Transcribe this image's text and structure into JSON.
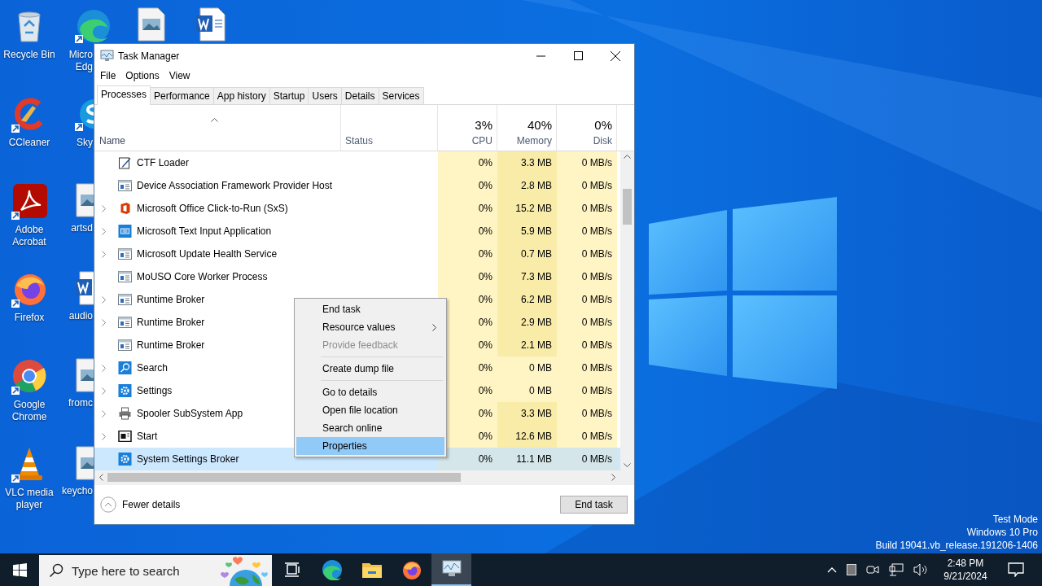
{
  "desktop_icons_top": [
    {
      "kind": "image"
    },
    {
      "kind": "word"
    }
  ],
  "desktop_icons": [
    {
      "label": "Recycle Bin",
      "kind": "recycle",
      "shortcut": false
    },
    {
      "label": "CCleaner",
      "kind": "ccleaner",
      "shortcut": true
    },
    {
      "label": "Adobe Acrobat",
      "kind": "acrobat",
      "shortcut": true
    },
    {
      "label": "Firefox",
      "kind": "firefox",
      "shortcut": true
    },
    {
      "label": "Google Chrome",
      "kind": "chrome",
      "shortcut": true
    },
    {
      "label": "VLC media player",
      "kind": "vlc",
      "shortcut": true
    }
  ],
  "desktop_icons_column_2": [
    {
      "label_lines": [
        "Micro",
        "Edg"
      ],
      "kind": "edge"
    },
    {
      "label_lines": [
        "Sky"
      ],
      "kind": "skype"
    },
    {
      "label_lines": [
        "artsd"
      ],
      "kind": "image"
    },
    {
      "label_lines": [
        "audio"
      ],
      "kind": "word"
    },
    {
      "label_lines": [
        "fromc"
      ],
      "kind": "image"
    },
    {
      "label_lines": [
        "keycho"
      ],
      "kind": "image"
    }
  ],
  "desktop_watermark": [
    "Test Mode",
    "Windows 10 Pro",
    "Build 19041.vb_release.191206-1406"
  ],
  "window": {
    "title": "Task Manager",
    "menu": [
      "File",
      "Options",
      "View"
    ],
    "tabs": [
      {
        "label": "Processes",
        "selected": true
      },
      {
        "label": "Performance",
        "selected": false
      },
      {
        "label": "App history",
        "selected": false
      },
      {
        "label": "Startup",
        "selected": false
      },
      {
        "label": "Users",
        "selected": false
      },
      {
        "label": "Details",
        "selected": false
      },
      {
        "label": "Services",
        "selected": false
      }
    ],
    "columns": [
      {
        "label": "Name",
        "sorted": true
      },
      {
        "label": "Status",
        "sorted": false
      },
      {
        "label": "CPU",
        "total": "3%",
        "sorted": false
      },
      {
        "label": "Memory",
        "total": "40%",
        "sorted": false
      },
      {
        "label": "Disk",
        "total": "0%",
        "sorted": false
      }
    ],
    "rows": [
      {
        "name": "CTF Loader",
        "kind": "pen",
        "expandable": false,
        "selected": false,
        "cpu": "0%",
        "memory": "3.3 MB",
        "color": "#f9eca8",
        "disk": "0 MB/s"
      },
      {
        "name": "Device Association Framework Provider Host",
        "kind": "window",
        "expandable": false,
        "selected": false,
        "cpu": "0%",
        "memory": "2.8 MB",
        "color": "#f9eca8",
        "disk": "0 MB/s"
      },
      {
        "name": "Microsoft Office Click-to-Run (SxS)",
        "kind": "office",
        "expandable": true,
        "selected": false,
        "cpu": "0%",
        "memory": "15.2 MB",
        "color": "#f9eca8",
        "disk": "0 MB/s"
      },
      {
        "name": "Microsoft Text Input Application",
        "kind": "keyboard",
        "expandable": true,
        "selected": false,
        "cpu": "0%",
        "memory": "5.9 MB",
        "color": "#f9eca8",
        "disk": "0 MB/s"
      },
      {
        "name": "Microsoft Update Health Service",
        "kind": "window",
        "expandable": true,
        "selected": false,
        "cpu": "0%",
        "memory": "0.7 MB",
        "color": "#f9eca8",
        "disk": "0 MB/s"
      },
      {
        "name": "MoUSO Core Worker Process",
        "kind": "window",
        "expandable": false,
        "selected": false,
        "cpu": "0%",
        "memory": "7.3 MB",
        "color": "#f9eca8",
        "disk": "0 MB/s"
      },
      {
        "name": "Runtime Broker",
        "kind": "window",
        "expandable": true,
        "selected": false,
        "cpu": "0%",
        "memory": "6.2 MB",
        "color": "#f9eca8",
        "disk": "0 MB/s"
      },
      {
        "name": "Runtime Broker",
        "kind": "window",
        "expandable": true,
        "selected": false,
        "cpu": "0%",
        "memory": "2.9 MB",
        "color": "#f9eca8",
        "disk": "0 MB/s"
      },
      {
        "name": "Runtime Broker",
        "kind": "window",
        "expandable": false,
        "selected": false,
        "cpu": "0%",
        "memory": "2.1 MB",
        "color": "#f9eca8",
        "disk": "0 MB/s"
      },
      {
        "name": "Search",
        "kind": "search",
        "expandable": true,
        "selected": false,
        "cpu": "0%",
        "memory": "0 MB",
        "color": "#fff4c4",
        "disk": "0 MB/s"
      },
      {
        "name": "Settings",
        "kind": "gear",
        "expandable": true,
        "selected": false,
        "cpu": "0%",
        "memory": "0 MB",
        "color": "#fff4c4",
        "disk": "0 MB/s"
      },
      {
        "name": "Spooler SubSystem App",
        "kind": "printer",
        "expandable": true,
        "selected": false,
        "cpu": "0%",
        "memory": "3.3 MB",
        "color": "#f9eca8",
        "disk": "0 MB/s"
      },
      {
        "name": "Start",
        "kind": "start",
        "expandable": true,
        "selected": false,
        "cpu": "0%",
        "memory": "12.6 MB",
        "color": "#f9eca8",
        "disk": "0 MB/s"
      },
      {
        "name": "System Settings Broker",
        "kind": "gear",
        "expandable": false,
        "selected": true,
        "cpu": "0%",
        "memory": "11.1 MB",
        "color": "#d5e6ea",
        "disk": "0 MB/s"
      }
    ],
    "footer": {
      "toggle": "Fewer details",
      "button": "End task"
    }
  },
  "context_menu": {
    "groups": [
      [
        {
          "label": "End task",
          "submenu": false,
          "disabled": false,
          "selected": false
        },
        {
          "label": "Resource values",
          "submenu": true,
          "disabled": false,
          "selected": false
        },
        {
          "label": "Provide feedback",
          "submenu": false,
          "disabled": true,
          "selected": false
        }
      ],
      [
        {
          "label": "Create dump file",
          "submenu": false,
          "disabled": false,
          "selected": false
        }
      ],
      [
        {
          "label": "Go to details",
          "submenu": false,
          "disabled": false,
          "selected": false
        },
        {
          "label": "Open file location",
          "submenu": false,
          "disabled": false,
          "selected": false
        },
        {
          "label": "Search online",
          "submenu": false,
          "disabled": false,
          "selected": false
        },
        {
          "label": "Properties",
          "submenu": false,
          "disabled": false,
          "selected": true
        }
      ]
    ]
  },
  "taskbar": {
    "search": {
      "placeholder": "Type here to search"
    },
    "apps": [
      {
        "kind": "taskview",
        "active": false
      },
      {
        "kind": "edge",
        "active": false
      },
      {
        "kind": "folder",
        "active": false
      },
      {
        "kind": "firefox",
        "active": false
      },
      {
        "kind": "taskmgr",
        "active": true
      }
    ],
    "time": "2:48 PM",
    "date": "9/21/2024"
  }
}
